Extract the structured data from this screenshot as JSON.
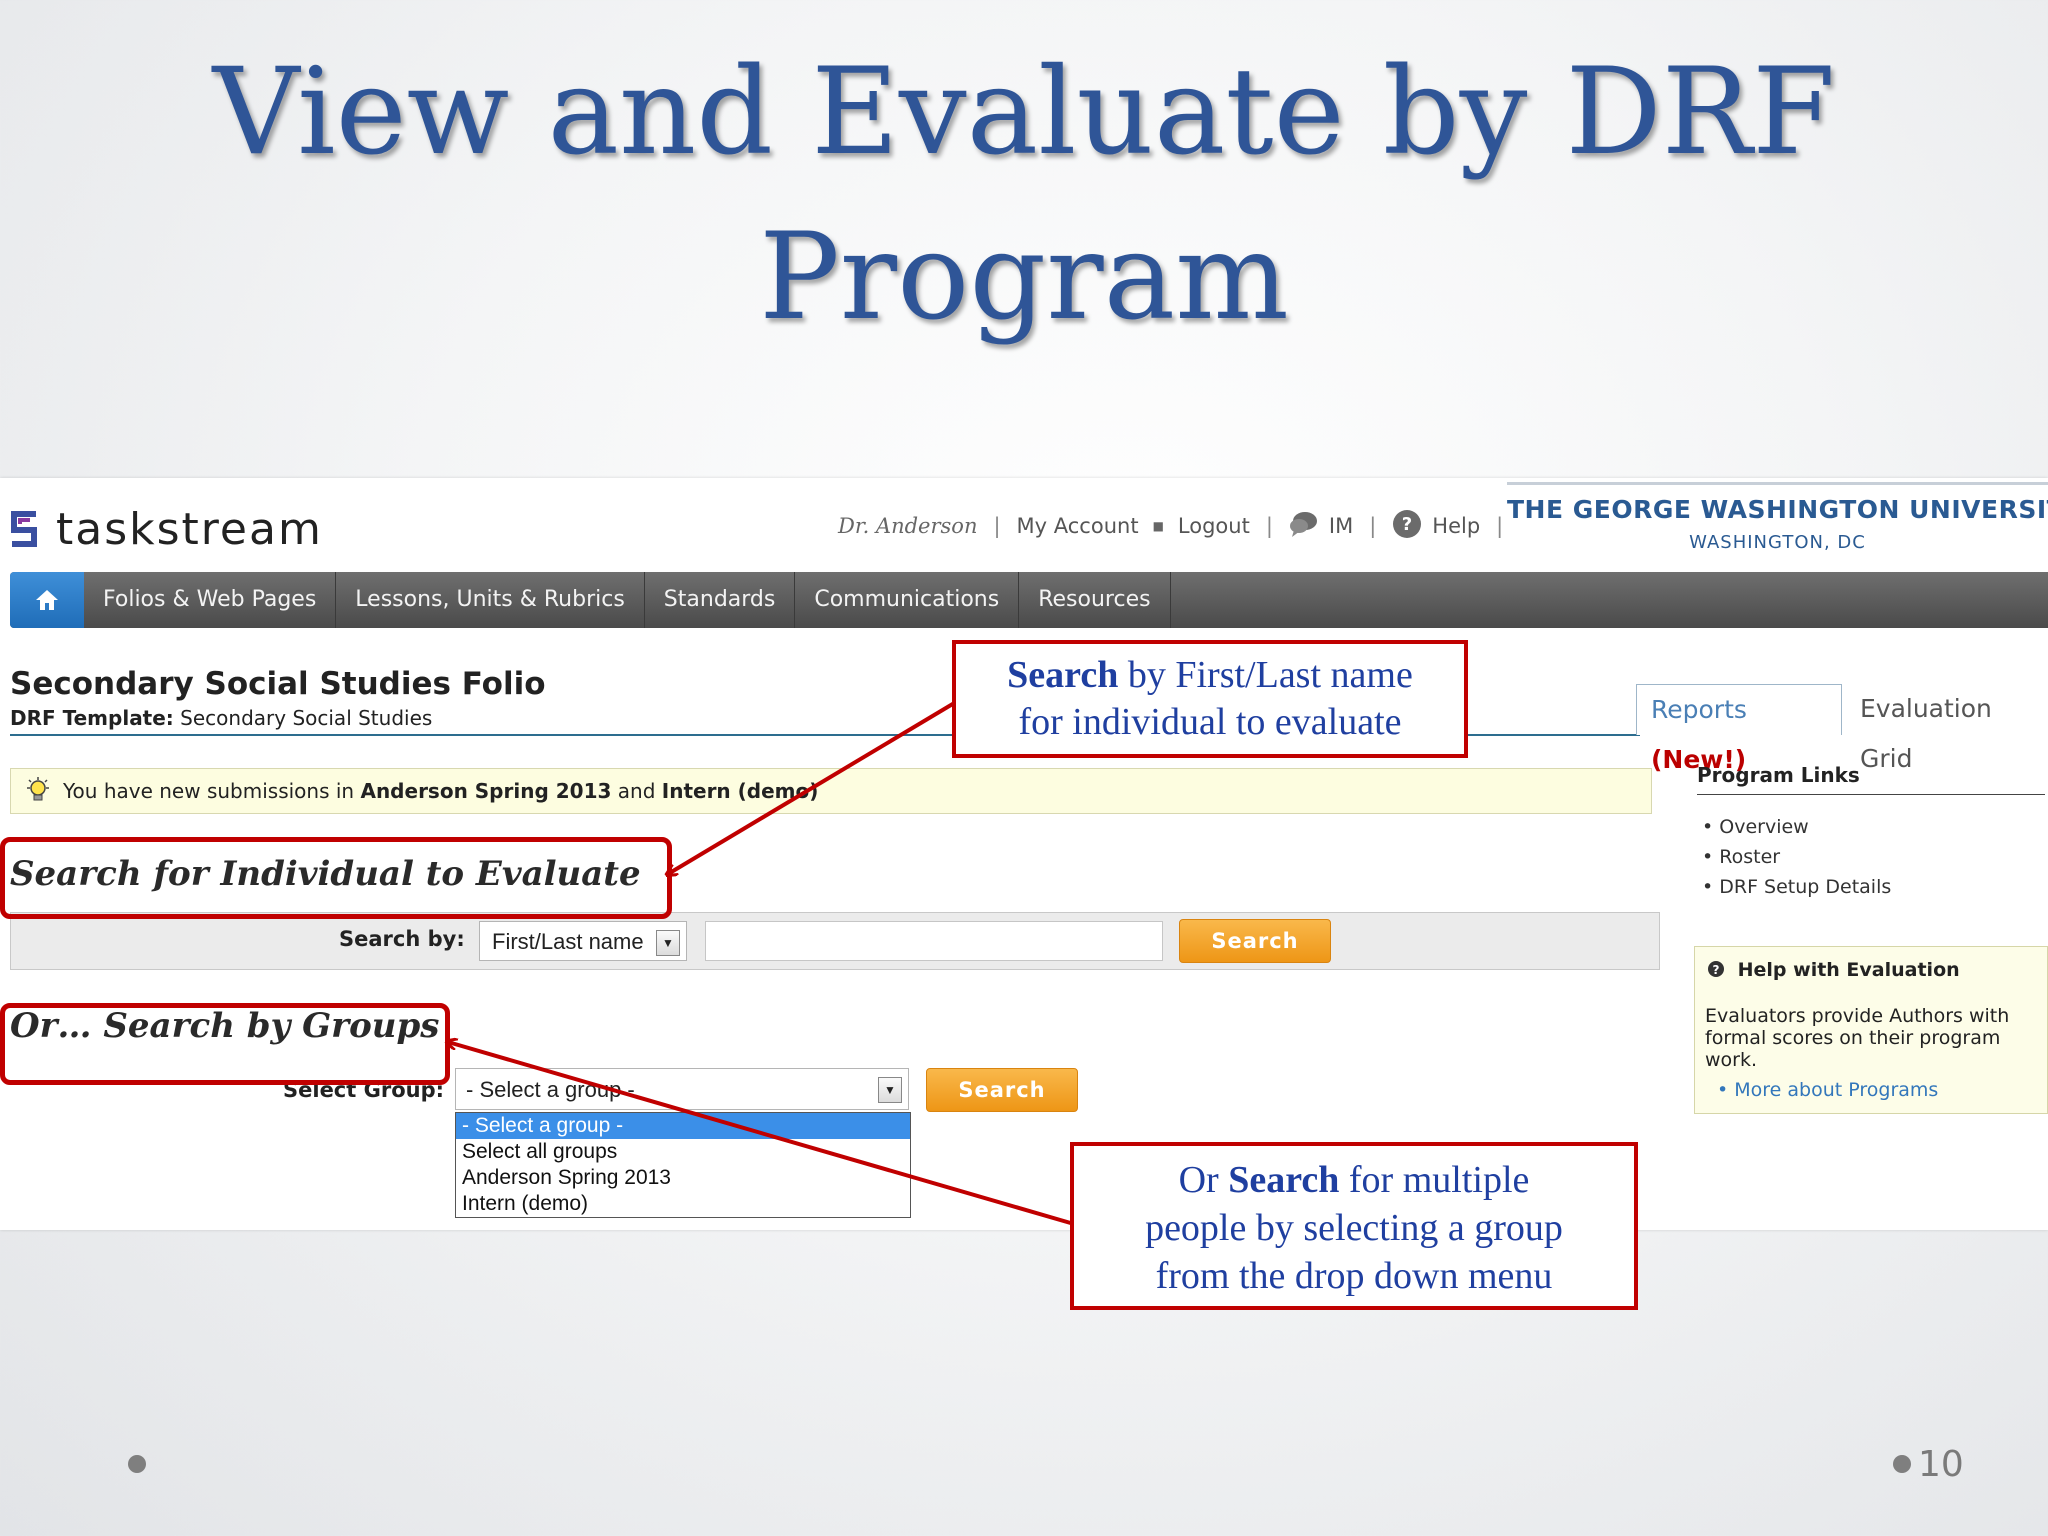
{
  "slide": {
    "title_line1": "View and Evaluate by DRF",
    "title_line2": "Program",
    "page_number": "10"
  },
  "app": {
    "logo_text": "taskstream",
    "user": "Dr. Anderson",
    "my_account": "My Account",
    "logout": "Logout",
    "im": "IM",
    "help": "Help",
    "university_name": "THE GEORGE WASHINGTON UNIVERSITY",
    "university_city": "WASHINGTON, DC"
  },
  "nav": {
    "items": [
      "Folios & Web Pages",
      "Lessons, Units & Rubrics",
      "Standards",
      "Communications",
      "Resources"
    ]
  },
  "folio": {
    "title": "Secondary Social Studies Folio",
    "template_label": "DRF Template:",
    "template_value": "Secondary Social Studies"
  },
  "tabs": {
    "reports": "Reports",
    "reports_badge": "(New!)",
    "evaluation_grid": "Evaluation Grid"
  },
  "notice": {
    "text_prefix": "You have new submissions in",
    "group1": "Anderson Spring 2013",
    "and": "and",
    "group2": "Intern (demo)"
  },
  "search_individual": {
    "heading": "Search for Individual to Evaluate",
    "label": "Search by:",
    "selected": "First/Last name",
    "input_value": "",
    "button": "Search"
  },
  "search_groups": {
    "heading": "Or… Search by Groups",
    "label": "Select Group:",
    "selected": "- Select a group -",
    "button": "Search",
    "options": [
      "- Select a group -",
      "Select all groups",
      "Anderson Spring 2013",
      "Intern (demo)"
    ]
  },
  "sidebar": {
    "program_links_title": "Program Links",
    "links": [
      "Overview",
      "Roster",
      "DRF Setup Details"
    ],
    "help_title": "Help with Evaluation",
    "help_text": "Evaluators provide Authors with formal scores on their program work.",
    "help_link": "More about Programs"
  },
  "callouts": {
    "c1_bold": "Search",
    "c1_rest1": " by First/Last name",
    "c1_line2": "for individual to evaluate",
    "c2_pre": "Or ",
    "c2_bold": "Search",
    "c2_rest1": " for multiple",
    "c2_line2": "people by selecting a group",
    "c2_line3": "from the drop down menu"
  },
  "colors": {
    "title_blue": "#2f5597",
    "annotation_red": "#c00000",
    "button_orange": "#f0a030",
    "nav_gray": "#555555",
    "home_blue": "#2a7cc7"
  }
}
